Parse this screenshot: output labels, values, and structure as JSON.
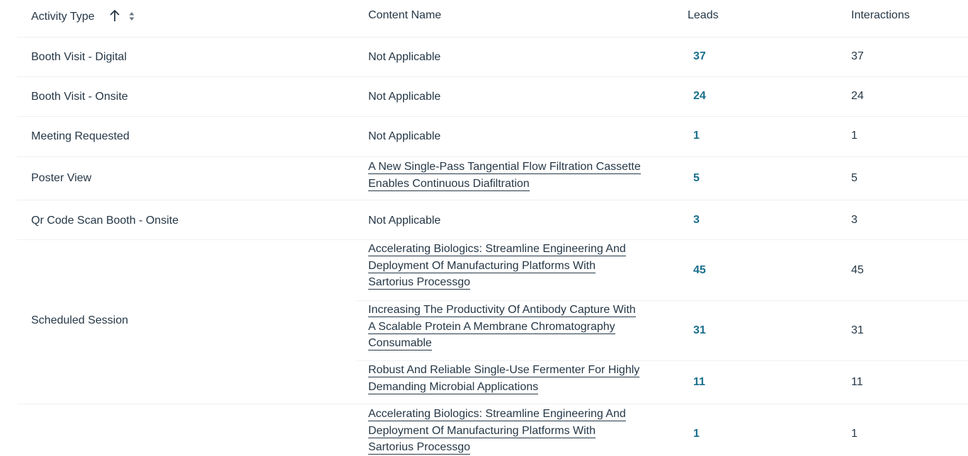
{
  "header": {
    "activity_type": "Activity Type",
    "content_name": "Content Name",
    "leads": "Leads",
    "interactions": "Interactions"
  },
  "rows": [
    {
      "activity": "Booth Visit - Digital",
      "content": "Not Applicable",
      "leads": "37",
      "interactions": "37"
    },
    {
      "activity": "Booth Visit - Onsite",
      "content": "Not Applicable",
      "leads": "24",
      "interactions": "24"
    },
    {
      "activity": "Meeting Requested",
      "content": "Not Applicable",
      "leads": "1",
      "interactions": "1"
    },
    {
      "activity": "Poster View",
      "content_lines": [
        "A New Single-Pass Tangential Flow Filtration Cassette",
        "Enables Continuous Diafiltration"
      ],
      "leads": "5",
      "interactions": "5"
    },
    {
      "activity": "Qr Code Scan Booth - Onsite",
      "content": "Not Applicable",
      "leads": "3",
      "interactions": "3"
    }
  ],
  "scheduled_session": {
    "activity": "Scheduled Session",
    "items": [
      {
        "content_lines": [
          "Accelerating Biologics: Streamline Engineering And",
          "Deployment Of Manufacturing Platforms With",
          "Sartorius Processgo"
        ],
        "leads": "45",
        "interactions": "45"
      },
      {
        "content_lines": [
          "Increasing The Productivity Of Antibody Capture With",
          "A Scalable Protein A Membrane Chromatography",
          "Consumable"
        ],
        "leads": "31",
        "interactions": "31"
      },
      {
        "content_lines": [
          "Robust And Reliable Single-Use Fermenter For Highly",
          "Demanding Microbial Applications"
        ],
        "leads": "11",
        "interactions": "11"
      }
    ]
  },
  "next_group": {
    "items": [
      {
        "content_lines": [
          "Accelerating Biologics: Streamline Engineering And",
          "Deployment Of Manufacturing Platforms With",
          "Sartorius Processgo"
        ],
        "leads": "1",
        "interactions": "1"
      }
    ]
  },
  "colors": {
    "text": "#253746",
    "leads_link": "#1a6f8c",
    "row_border": "#eef0f2",
    "sort_icon": "#6b7785"
  },
  "icons": {
    "sort_ascending": "arrow-up-icon",
    "sort_toggle": "sort-both-icon"
  }
}
